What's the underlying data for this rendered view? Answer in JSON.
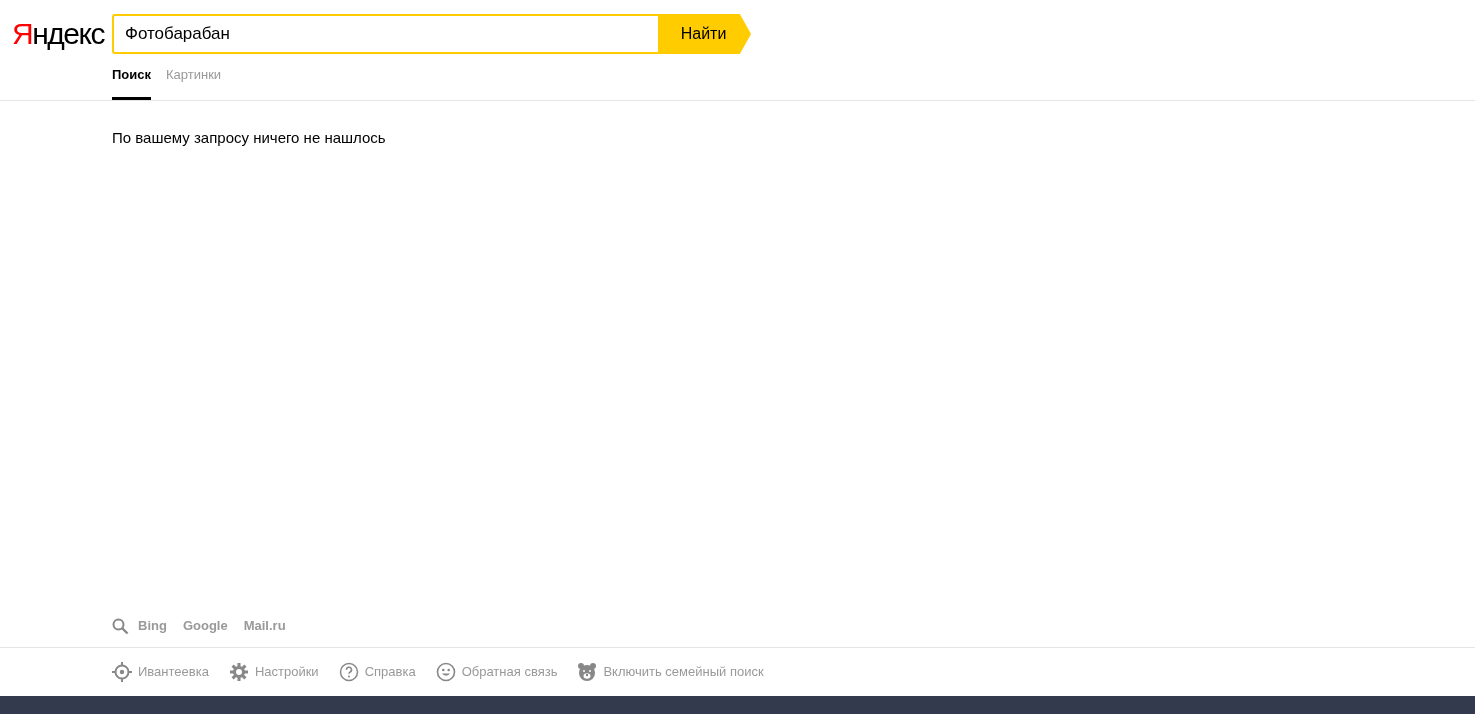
{
  "logo": "Яндекс",
  "search": {
    "value": "Фотобарабан",
    "button": "Найти"
  },
  "tabs": [
    {
      "label": "Поиск",
      "selected": true
    },
    {
      "label": "Картинки",
      "selected": false
    }
  ],
  "message": "По вашему запросу ничего не нашлось",
  "engines": [
    "Bing",
    "Google",
    "Mail.ru"
  ],
  "footer_links": [
    {
      "kind": "location",
      "label": "Ивантеевка"
    },
    {
      "kind": "settings",
      "label": "Настройки"
    },
    {
      "kind": "help",
      "label": "Справка"
    },
    {
      "kind": "feedback",
      "label": "Обратная связь"
    },
    {
      "kind": "family",
      "label": "Включить семейный поиск"
    }
  ]
}
